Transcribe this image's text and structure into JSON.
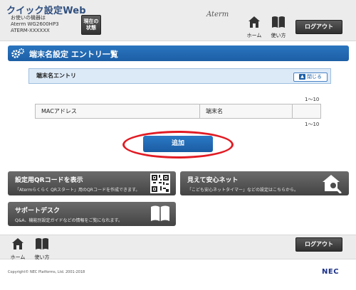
{
  "header": {
    "app_title": "クイック設定Web",
    "device_label": "お使いの機器は",
    "device_model": "Aterm WG2600HP3",
    "device_ssid": "ATERM-XXXXXX",
    "status_button_line1": "現在の",
    "status_button_line2": "状態",
    "brand": "Aterm",
    "home_label": "ホーム",
    "guide_label": "使い方",
    "logout_label": "ログアウト"
  },
  "section": {
    "title": "端末名設定 エントリ一覧"
  },
  "entry_panel": {
    "title": "端末名エントリ",
    "close_label": "閉じる",
    "range_top": "1〜10",
    "range_bottom": "1〜10",
    "columns": [
      "MACアドレス",
      "端末名",
      ""
    ]
  },
  "add_button": {
    "label": "追加"
  },
  "tiles": {
    "qr": {
      "title": "設定用QRコードを表示",
      "desc": "「Atermらくらく QRスタート」用のQRコードを作成できます。"
    },
    "safety": {
      "title": "見えて安心ネット",
      "desc": "「こども安心ネットタイマー」などの設定はこちらから。"
    },
    "support": {
      "title": "サポートデスク",
      "desc": "Q&A、機能別設定ガイドなどの情報をご覧になれます。"
    }
  },
  "footer": {
    "home_label": "ホーム",
    "guide_label": "使い方",
    "logout_label": "ログアウト",
    "copyright": "Copyright© NEC Platforms, Ltd. 2001-2018",
    "nec_logo": "NEC"
  },
  "colors": {
    "accent_blue": "#1c5fa6",
    "highlight_red": "#e21b23",
    "tile_gray": "#555555"
  }
}
